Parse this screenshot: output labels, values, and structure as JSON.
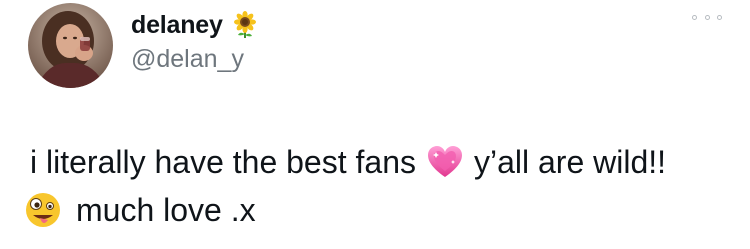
{
  "profile": {
    "display_name": "delaney",
    "name_emoji": "sunflower-icon",
    "handle": "@delan_y"
  },
  "menu": {
    "icon": "more-options-icon"
  },
  "tweet": {
    "line1_text_a": "i literally have the best fans",
    "line1_emoji": "sparkling-heart-icon",
    "line1_text_b": "y’all are wild!!",
    "line2_emoji": "zany-face-icon",
    "line2_text": "much love .x"
  }
}
